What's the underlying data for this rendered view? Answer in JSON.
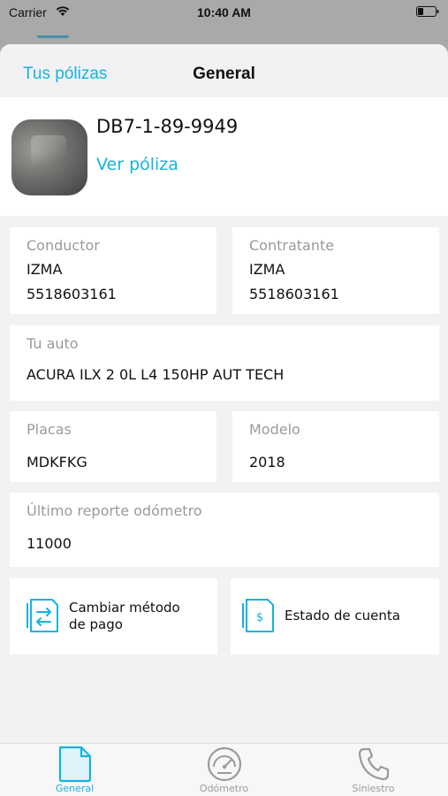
{
  "status_bar": {
    "carrier": "Carrier",
    "time": "10:40 AM"
  },
  "nav": {
    "back_label": "Tus pólizas",
    "title": "General"
  },
  "policy": {
    "number": "DB7-1-89-9949",
    "view_link": "Ver póliza"
  },
  "driver": {
    "label": "Conductor",
    "name": "IZMA",
    "phone": "5518603161"
  },
  "contractor": {
    "label": "Contratante",
    "name": "IZMA",
    "phone": "5518603161"
  },
  "car": {
    "label": "Tu auto",
    "value": "ACURA ILX 2 0L L4 150HP AUT TECH"
  },
  "plates": {
    "label": "Placas",
    "value": "MDKFKG"
  },
  "model": {
    "label": "Modelo",
    "value": "2018"
  },
  "odometer_report": {
    "label": "Último reporte odómetro",
    "value": "11000"
  },
  "actions": {
    "payment_method": {
      "line1": "Cambiar método",
      "line2": "de pago",
      "icon": "swap-card-icon"
    },
    "account_statement": {
      "label": "Estado de cuenta",
      "icon": "dollar-document-icon"
    }
  },
  "tabs": [
    {
      "label": "General",
      "icon": "document-icon",
      "active": true
    },
    {
      "label": "Odómetro",
      "icon": "speedometer-icon",
      "active": false
    },
    {
      "label": "Siniestro",
      "icon": "phone-icon",
      "active": false
    }
  ],
  "colors": {
    "accent": "#16b2df",
    "muted": "#9a9a9a",
    "background": "#f2f2f4"
  }
}
